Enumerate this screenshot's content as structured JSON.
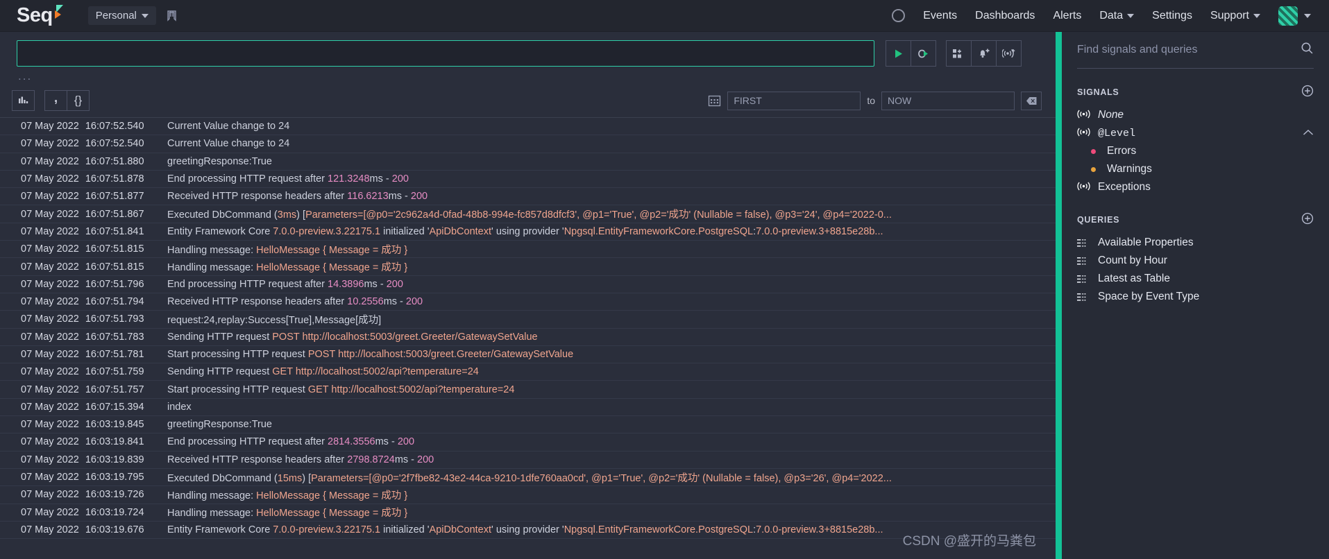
{
  "app": {
    "brand": "Seq",
    "scope_label": "Personal",
    "watermark": "CSDN @盛开的马粪包"
  },
  "topnav": {
    "theme_toggle_icon": "moon-icon",
    "bookmark_icon": "bookmark-icon",
    "links": [
      {
        "label": "Events",
        "has_caret": false
      },
      {
        "label": "Dashboards",
        "has_caret": false
      },
      {
        "label": "Alerts",
        "has_caret": false
      },
      {
        "label": "Data",
        "has_caret": true
      },
      {
        "label": "Settings",
        "has_caret": false
      },
      {
        "label": "Support",
        "has_caret": true
      }
    ]
  },
  "querybar": {
    "query_value": "",
    "ellipsis": "...",
    "buttons": [
      {
        "name": "run-query-button",
        "icon": "play-icon",
        "label": ""
      },
      {
        "name": "live-tail-button",
        "icon": "infinity-play-icon",
        "label": ""
      },
      {
        "name": "add-to-dashboard-button",
        "icon": "dashboard-plus-icon",
        "label": ""
      },
      {
        "name": "create-alert-button",
        "icon": "bell-plus-icon",
        "label": ""
      },
      {
        "name": "create-signal-button",
        "icon": "signal-plus-icon",
        "label": ""
      }
    ],
    "view_buttons": [
      {
        "name": "chart-view-button",
        "icon": "bar-chart-icon",
        "glyph": ""
      },
      {
        "name": "csv-export-button",
        "icon": "comma-icon",
        "glyph": ","
      },
      {
        "name": "json-export-button",
        "icon": "braces-icon",
        "glyph": "{}"
      }
    ],
    "range": {
      "calendar_icon": "calendar-icon",
      "from_value": "FIRST",
      "to_separator": "to",
      "to_value": "NOW",
      "clear_icon": "clear-range-icon"
    }
  },
  "events": [
    {
      "date": "07 May 2022",
      "time": "16:07:52.540",
      "parts": [
        {
          "t": "txt",
          "v": "Current Value change to 24"
        }
      ]
    },
    {
      "date": "07 May 2022",
      "time": "16:07:52.540",
      "parts": [
        {
          "t": "txt",
          "v": "Current Value change to 24"
        }
      ]
    },
    {
      "date": "07 May 2022",
      "time": "16:07:51.880",
      "parts": [
        {
          "t": "txt",
          "v": "greetingResponse:True"
        }
      ]
    },
    {
      "date": "07 May 2022",
      "time": "16:07:51.878",
      "parts": [
        {
          "t": "txt",
          "v": "End processing HTTP request after "
        },
        {
          "t": "num",
          "v": "121.3248"
        },
        {
          "t": "txt",
          "v": "ms - "
        },
        {
          "t": "num",
          "v": "200"
        }
      ]
    },
    {
      "date": "07 May 2022",
      "time": "16:07:51.877",
      "parts": [
        {
          "t": "txt",
          "v": "Received HTTP response headers after "
        },
        {
          "t": "num",
          "v": "116.6213"
        },
        {
          "t": "txt",
          "v": "ms - "
        },
        {
          "t": "num",
          "v": "200"
        }
      ]
    },
    {
      "date": "07 May 2022",
      "time": "16:07:51.867",
      "parts": [
        {
          "t": "txt",
          "v": "Executed DbCommand ("
        },
        {
          "t": "str",
          "v": "3ms"
        },
        {
          "t": "txt",
          "v": ") ["
        },
        {
          "t": "str",
          "v": "Parameters=[@p0='2c962a4d-0fad-48b8-994e-fc857d8dfcf3', @p1='True', @p2='成功' (Nullable = false), @p3='24', @p4='2022-0..."
        }
      ]
    },
    {
      "date": "07 May 2022",
      "time": "16:07:51.841",
      "parts": [
        {
          "t": "txt",
          "v": "Entity Framework Core "
        },
        {
          "t": "str",
          "v": "7.0.0-preview.3.22175.1"
        },
        {
          "t": "txt",
          "v": " initialized '"
        },
        {
          "t": "str",
          "v": "ApiDbContext"
        },
        {
          "t": "txt",
          "v": "' using provider '"
        },
        {
          "t": "str",
          "v": "Npgsql.EntityFrameworkCore.PostgreSQL"
        },
        {
          "t": "txt",
          "v": ":"
        },
        {
          "t": "str",
          "v": "7.0.0-preview.3+8815e28b..."
        }
      ]
    },
    {
      "date": "07 May 2022",
      "time": "16:07:51.815",
      "parts": [
        {
          "t": "txt",
          "v": "Handling message: "
        },
        {
          "t": "str",
          "v": "HelloMessage { Message = 成功 }"
        }
      ]
    },
    {
      "date": "07 May 2022",
      "time": "16:07:51.815",
      "parts": [
        {
          "t": "txt",
          "v": "Handling message: "
        },
        {
          "t": "str",
          "v": "HelloMessage { Message = 成功 }"
        }
      ]
    },
    {
      "date": "07 May 2022",
      "time": "16:07:51.796",
      "parts": [
        {
          "t": "txt",
          "v": "End processing HTTP request after "
        },
        {
          "t": "num",
          "v": "14.3896"
        },
        {
          "t": "txt",
          "v": "ms - "
        },
        {
          "t": "num",
          "v": "200"
        }
      ]
    },
    {
      "date": "07 May 2022",
      "time": "16:07:51.794",
      "parts": [
        {
          "t": "txt",
          "v": "Received HTTP response headers after "
        },
        {
          "t": "num",
          "v": "10.2556"
        },
        {
          "t": "txt",
          "v": "ms - "
        },
        {
          "t": "num",
          "v": "200"
        }
      ]
    },
    {
      "date": "07 May 2022",
      "time": "16:07:51.793",
      "parts": [
        {
          "t": "txt",
          "v": "request:24,replay:Success[True],Message[成功]"
        }
      ]
    },
    {
      "date": "07 May 2022",
      "time": "16:07:51.783",
      "parts": [
        {
          "t": "txt",
          "v": "Sending HTTP request "
        },
        {
          "t": "url",
          "v": "POST http://localhost:5003/greet.Greeter/GatewaySetValue"
        }
      ]
    },
    {
      "date": "07 May 2022",
      "time": "16:07:51.781",
      "parts": [
        {
          "t": "txt",
          "v": "Start processing HTTP request "
        },
        {
          "t": "url",
          "v": "POST http://localhost:5003/greet.Greeter/GatewaySetValue"
        }
      ]
    },
    {
      "date": "07 May 2022",
      "time": "16:07:51.759",
      "parts": [
        {
          "t": "txt",
          "v": "Sending HTTP request "
        },
        {
          "t": "url",
          "v": "GET http://localhost:5002/api?temperature=24"
        }
      ]
    },
    {
      "date": "07 May 2022",
      "time": "16:07:51.757",
      "parts": [
        {
          "t": "txt",
          "v": "Start processing HTTP request "
        },
        {
          "t": "url",
          "v": "GET http://localhost:5002/api?temperature=24"
        }
      ]
    },
    {
      "date": "07 May 2022",
      "time": "16:07:15.394",
      "parts": [
        {
          "t": "txt",
          "v": "index"
        }
      ]
    },
    {
      "date": "07 May 2022",
      "time": "16:03:19.845",
      "parts": [
        {
          "t": "txt",
          "v": "greetingResponse:True"
        }
      ]
    },
    {
      "date": "07 May 2022",
      "time": "16:03:19.841",
      "parts": [
        {
          "t": "txt",
          "v": "End processing HTTP request after "
        },
        {
          "t": "num",
          "v": "2814.3556"
        },
        {
          "t": "txt",
          "v": "ms - "
        },
        {
          "t": "num",
          "v": "200"
        }
      ]
    },
    {
      "date": "07 May 2022",
      "time": "16:03:19.839",
      "parts": [
        {
          "t": "txt",
          "v": "Received HTTP response headers after "
        },
        {
          "t": "num",
          "v": "2798.8724"
        },
        {
          "t": "txt",
          "v": "ms - "
        },
        {
          "t": "num",
          "v": "200"
        }
      ]
    },
    {
      "date": "07 May 2022",
      "time": "16:03:19.795",
      "parts": [
        {
          "t": "txt",
          "v": "Executed DbCommand ("
        },
        {
          "t": "str",
          "v": "15ms"
        },
        {
          "t": "txt",
          "v": ") ["
        },
        {
          "t": "str",
          "v": "Parameters=[@p0='2f7fbe82-43e2-44ca-9210-1dfe760aa0cd', @p1='True', @p2='成功' (Nullable = false), @p3='26', @p4='2022..."
        }
      ]
    },
    {
      "date": "07 May 2022",
      "time": "16:03:19.726",
      "parts": [
        {
          "t": "txt",
          "v": "Handling message: "
        },
        {
          "t": "str",
          "v": "HelloMessage { Message = 成功 }"
        }
      ]
    },
    {
      "date": "07 May 2022",
      "time": "16:03:19.724",
      "parts": [
        {
          "t": "txt",
          "v": "Handling message: "
        },
        {
          "t": "str",
          "v": "HelloMessage { Message = 成功 }"
        }
      ]
    },
    {
      "date": "07 May 2022",
      "time": "16:03:19.676",
      "parts": [
        {
          "t": "txt",
          "v": "Entity Framework Core "
        },
        {
          "t": "str",
          "v": "7.0.0-preview.3.22175.1"
        },
        {
          "t": "txt",
          "v": " initialized '"
        },
        {
          "t": "str",
          "v": "ApiDbContext"
        },
        {
          "t": "txt",
          "v": "' using provider '"
        },
        {
          "t": "str",
          "v": "Npgsql.EntityFrameworkCore.PostgreSQL"
        },
        {
          "t": "txt",
          "v": ":"
        },
        {
          "t": "str",
          "v": "7.0.0-preview.3+8815e28b..."
        }
      ]
    }
  ],
  "sidebar": {
    "search_placeholder": "Find signals and queries",
    "search_icon": "search-icon",
    "signals_heading": "SIGNALS",
    "signals_add_icon": "plus-circle-icon",
    "signals": [
      {
        "label": "None",
        "icon": "signal-icon",
        "italic": true,
        "mono": false,
        "indent": false,
        "dot": null,
        "chevron": null
      },
      {
        "label": "@Level",
        "icon": "signal-icon",
        "italic": false,
        "mono": true,
        "indent": false,
        "dot": null,
        "chevron": "chevron-up-icon"
      },
      {
        "label": "Errors",
        "icon": null,
        "italic": false,
        "mono": false,
        "indent": true,
        "dot": "#ef4b7b",
        "chevron": null
      },
      {
        "label": "Warnings",
        "icon": null,
        "italic": false,
        "mono": false,
        "indent": true,
        "dot": "#e8a33d",
        "chevron": null
      },
      {
        "label": "Exceptions",
        "icon": "signal-icon",
        "italic": false,
        "mono": false,
        "indent": false,
        "dot": null,
        "chevron": null
      }
    ],
    "queries_heading": "QUERIES",
    "queries_add_icon": "plus-circle-icon",
    "queries": [
      {
        "label": "Available Properties",
        "icon": "query-icon"
      },
      {
        "label": "Count by Hour",
        "icon": "query-icon"
      },
      {
        "label": "Latest as Table",
        "icon": "query-icon"
      },
      {
        "label": "Space by Event Type",
        "icon": "query-icon"
      }
    ]
  },
  "colors": {
    "accent": "#13c296",
    "error_dot": "#ef4b7b",
    "warning_dot": "#e8a33d",
    "background": "#2a2e3b",
    "panel": "#272b36"
  }
}
